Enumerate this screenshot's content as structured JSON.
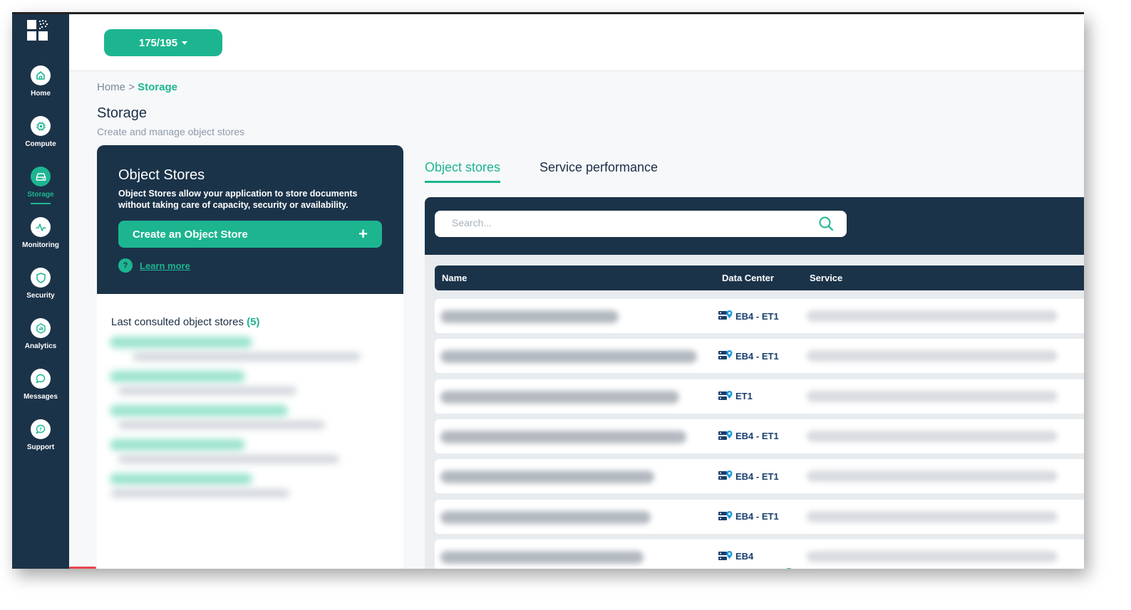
{
  "sidebar": {
    "items": [
      {
        "label": "Home",
        "icon": "home-icon"
      },
      {
        "label": "Compute",
        "icon": "chip-icon"
      },
      {
        "label": "Storage",
        "icon": "storage-icon"
      },
      {
        "label": "Monitoring",
        "icon": "pulse-icon"
      },
      {
        "label": "Security",
        "icon": "shield-icon"
      },
      {
        "label": "Analytics",
        "icon": "analytics-icon"
      },
      {
        "label": "Messages",
        "icon": "chat-icon"
      },
      {
        "label": "Support",
        "icon": "support-icon"
      }
    ],
    "active": "Storage"
  },
  "topbar": {
    "counter_label": "175/195"
  },
  "breadcrumb": {
    "home": "Home",
    "separator": ">",
    "current": "Storage"
  },
  "page": {
    "title": "Storage",
    "subtitle": "Create and manage object stores"
  },
  "info_panel": {
    "title": "Object Stores",
    "description": "Object Stores allow your application to store documents without taking care of capacity, security or availability.",
    "create_button_label": "Create an Object Store",
    "help_icon_glyph": "?",
    "learn_more_label": "Learn more"
  },
  "last_consulted": {
    "title": "Last consulted object stores",
    "count": "(5)"
  },
  "tabs": [
    {
      "label": "Object stores",
      "active": true
    },
    {
      "label": "Service performance",
      "active": false
    }
  ],
  "search": {
    "placeholder": "Search..."
  },
  "table": {
    "columns": [
      "Name",
      "Data Center",
      "Service"
    ],
    "rows": [
      {
        "data_center": "EB4 - ET1"
      },
      {
        "data_center": "EB4 - ET1"
      },
      {
        "data_center": "ET1"
      },
      {
        "data_center": "EB4 - ET1"
      },
      {
        "data_center": "EB4 - ET1"
      },
      {
        "data_center": "EB4 - ET1"
      },
      {
        "data_center": "EB4"
      }
    ]
  },
  "colors": {
    "accent": "#1db590",
    "navy": "#1b3349",
    "danger": "#e8434f"
  }
}
